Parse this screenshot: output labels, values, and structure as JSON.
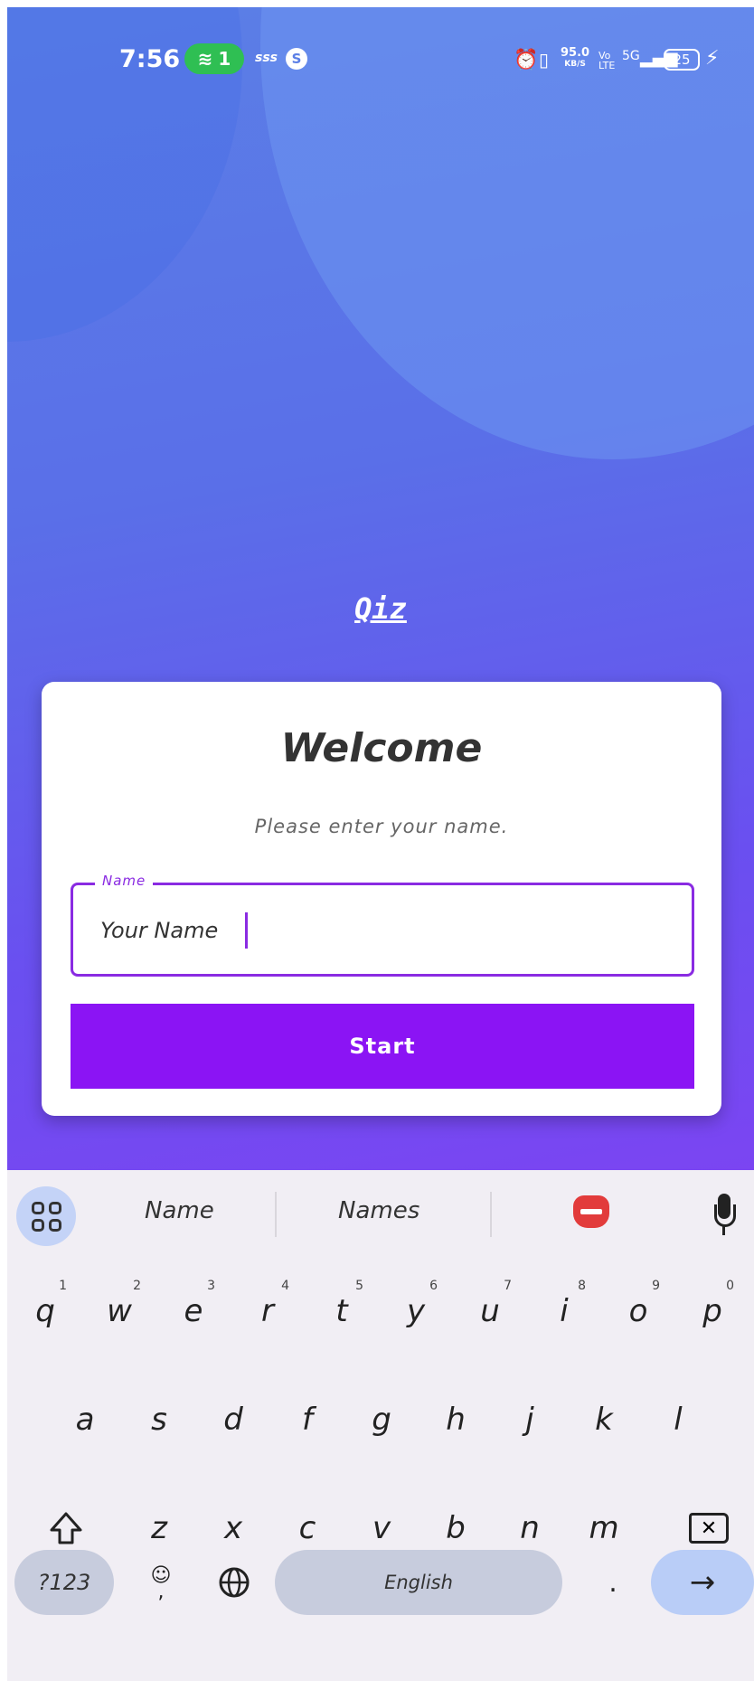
{
  "status_bar": {
    "time": "7:56",
    "wifi_count": "1",
    "small_text": "sss",
    "net_speed_value": "95.0",
    "net_speed_unit": "KB/S",
    "volte": "Vo LTE",
    "signal": "5G",
    "battery": "25"
  },
  "app": {
    "logo": "Qiz",
    "card": {
      "title": "Welcome",
      "subtitle": "Please enter your name.",
      "name_label": "Name",
      "name_value": "Your Name",
      "start_label": "Start"
    },
    "colors": {
      "primary": "#8b14f4",
      "gradient_top": "#5b7fe6",
      "gradient_bottom": "#7b45f2"
    }
  },
  "keyboard": {
    "suggestions": [
      "Name",
      "Names"
    ],
    "row1": [
      {
        "k": "q",
        "n": "1"
      },
      {
        "k": "w",
        "n": "2"
      },
      {
        "k": "e",
        "n": "3"
      },
      {
        "k": "r",
        "n": "4"
      },
      {
        "k": "t",
        "n": "5"
      },
      {
        "k": "y",
        "n": "6"
      },
      {
        "k": "u",
        "n": "7"
      },
      {
        "k": "i",
        "n": "8"
      },
      {
        "k": "o",
        "n": "9"
      },
      {
        "k": "p",
        "n": "0"
      }
    ],
    "row2": [
      "a",
      "s",
      "d",
      "f",
      "g",
      "h",
      "j",
      "k",
      "l"
    ],
    "row3": [
      "z",
      "x",
      "c",
      "v",
      "b",
      "n",
      "m"
    ],
    "symbols_label": "?123",
    "emoji_comma": ",",
    "space_label": "English",
    "period": ".",
    "enter_symbol": "→",
    "icons": [
      "apps-grid-icon",
      "sticker-icon",
      "mic-icon",
      "shift-icon",
      "backspace-icon",
      "emoji-icon",
      "globe-icon"
    ]
  }
}
